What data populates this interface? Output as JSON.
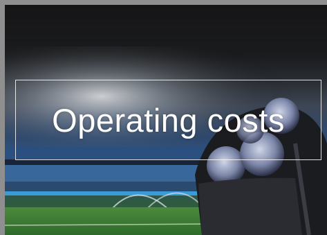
{
  "slide": {
    "title": "Operating costs",
    "image_icon": "stadium-photo"
  },
  "colors": {
    "frame": "#8f8f8f",
    "title_text": "#ffffff",
    "title_border": "#ffffff"
  }
}
